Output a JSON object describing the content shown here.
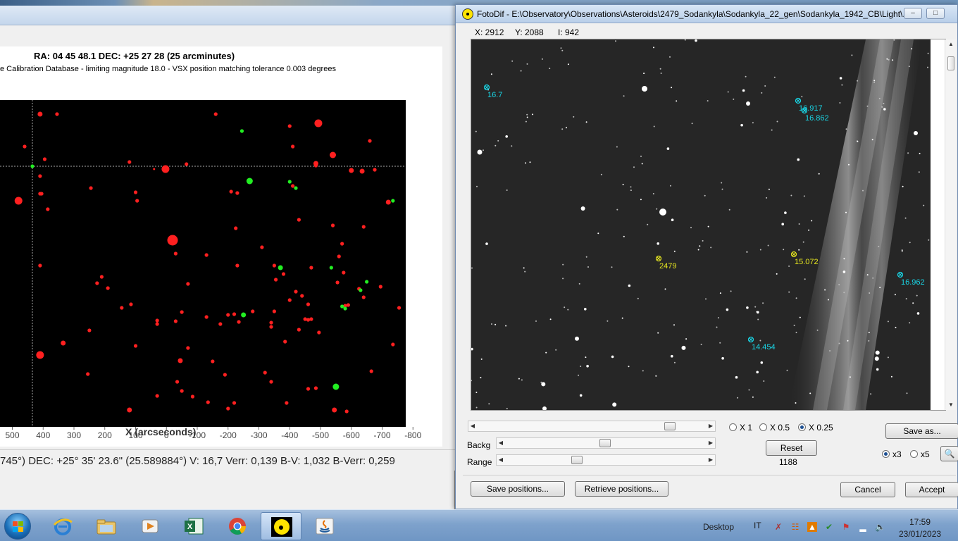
{
  "chart_window": {
    "title": "RA: 04 45 48.1  DEC: +25 27 28 (25 arcminutes)",
    "subtitle": "e Calibration Database - limiting magnitude 18.0 - VSX position matching tolerance 0.003 degrees",
    "x_axis_label": "X (arcseconds)",
    "status": "745°)   DEC: +25° 35' 23.6\" (25.589884°)   V: 16,7    Verr: 0,139   B-V: 1,032   B-Verr: 0,259"
  },
  "chart_data": {
    "type": "scatter",
    "title": "RA: 04 45 48.1  DEC: +25 27 28 (25 arcminutes)",
    "xlabel": "X (arcseconds)",
    "xlim": [
      540,
      -820
    ],
    "x_ticks": [
      "500",
      "400",
      "300",
      "200",
      "100",
      "0",
      "-100",
      "-200",
      "-300",
      "-400",
      "-500",
      "-600",
      "-700",
      "-800"
    ],
    "crosshair": {
      "x": 435
    },
    "series": [
      {
        "color": "#ff2020",
        "points": [
          [
            410,
            20,
            3
          ],
          [
            355,
            20,
            2
          ],
          [
            -160,
            20,
            2
          ],
          [
            -493,
            33,
            5
          ],
          [
            -400,
            37,
            2
          ],
          [
            -660,
            58,
            2
          ],
          [
            460,
            66,
            2
          ],
          [
            -410,
            66,
            2
          ],
          [
            -540,
            78,
            4
          ],
          [
            395,
            84,
            2
          ],
          [
            120,
            88,
            2
          ],
          [
            -485,
            90,
            3
          ],
          [
            -600,
            100,
            3
          ],
          [
            3,
            98,
            5
          ],
          [
            -65,
            91,
            2
          ],
          [
            -635,
            101,
            3
          ],
          [
            -676,
            99,
            2
          ],
          [
            410,
            108,
            2
          ],
          [
            -485,
            93,
            2
          ],
          [
            40,
            98,
            0
          ],
          [
            480,
            143,
            5
          ],
          [
            405,
            133,
            2
          ],
          [
            245,
            125,
            2
          ],
          [
            -230,
            132,
            2
          ],
          [
            -210,
            130,
            2
          ],
          [
            -410,
            122,
            2
          ],
          [
            410,
            133,
            2
          ],
          [
            100,
            131,
            2
          ],
          [
            -720,
            145,
            3
          ],
          [
            385,
            155,
            2
          ],
          [
            95,
            143,
            2
          ],
          [
            -430,
            170,
            2
          ],
          [
            -540,
            178,
            2
          ],
          [
            -640,
            180,
            2
          ],
          [
            -225,
            182,
            2
          ],
          [
            -20,
            199,
            7
          ],
          [
            -30,
            218,
            2
          ],
          [
            -130,
            220,
            2
          ],
          [
            -570,
            204,
            2
          ],
          [
            -310,
            209,
            2
          ],
          [
            -560,
            222,
            2
          ],
          [
            410,
            235,
            2
          ],
          [
            210,
            251,
            2
          ],
          [
            -230,
            235,
            2
          ],
          [
            -350,
            235,
            2
          ],
          [
            -380,
            247,
            2
          ],
          [
            -575,
            245,
            2
          ],
          [
            -470,
            238,
            2
          ],
          [
            225,
            260,
            2
          ],
          [
            190,
            267,
            2
          ],
          [
            -70,
            261,
            2
          ],
          [
            -355,
            255,
            2
          ],
          [
            -555,
            259,
            2
          ],
          [
            -625,
            268,
            2
          ],
          [
            -695,
            265,
            2
          ],
          [
            -420,
            272,
            2
          ],
          [
            -440,
            278,
            2
          ],
          [
            -590,
            291,
            2
          ],
          [
            -640,
            280,
            2
          ],
          [
            -400,
            284,
            2
          ],
          [
            -460,
            290,
            2
          ],
          [
            145,
            295,
            2
          ],
          [
            115,
            290,
            2
          ],
          [
            -350,
            300,
            2
          ],
          [
            -470,
            311,
            2
          ],
          [
            -580,
            292,
            2
          ],
          [
            -200,
            305,
            2
          ],
          [
            -755,
            295,
            2
          ],
          [
            -235,
            315,
            2
          ],
          [
            -50,
            301,
            2
          ],
          [
            -340,
            316,
            2
          ],
          [
            -30,
            314,
            2
          ],
          [
            -175,
            318,
            2
          ],
          [
            250,
            327,
            2
          ],
          [
            30,
            318,
            2
          ],
          [
            30,
            313,
            2
          ],
          [
            -460,
            312,
            2
          ],
          [
            410,
            362,
            5
          ],
          [
            -340,
            322,
            2
          ],
          [
            335,
            345,
            3
          ],
          [
            -385,
            343,
            2
          ],
          [
            -735,
            347,
            2
          ],
          [
            -70,
            352,
            2
          ],
          [
            100,
            349,
            2
          ],
          [
            255,
            389,
            2
          ],
          [
            -45,
            370,
            3
          ],
          [
            -150,
            371,
            2
          ],
          [
            -430,
            326,
            2
          ],
          [
            120,
            440,
            3
          ],
          [
            -340,
            400,
            2
          ],
          [
            -545,
            440,
            3
          ],
          [
            -460,
            410,
            2
          ],
          [
            -85,
            421,
            2
          ],
          [
            -220,
            430,
            2
          ],
          [
            -35,
            400,
            2
          ],
          [
            -200,
            438,
            2
          ],
          [
            -585,
            442,
            2
          ],
          [
            -390,
            430,
            2
          ],
          [
            -135,
            429,
            2
          ],
          [
            -485,
            409,
            2
          ],
          [
            -665,
            385,
            2
          ],
          [
            -50,
            413,
            2
          ],
          [
            30,
            420,
            2
          ],
          [
            -220,
            304,
            2
          ],
          [
            -280,
            300,
            2
          ],
          [
            -130,
            308,
            2
          ],
          [
            -320,
            387,
            2
          ],
          [
            -190,
            390,
            2
          ],
          [
            -450,
            311,
            2
          ],
          [
            -495,
            330,
            2
          ]
        ]
      },
      {
        "color": "#22ee22",
        "points": [
          [
            435,
            94,
            2
          ],
          [
            -245,
            44,
            2
          ],
          [
            -270,
            115,
            4
          ],
          [
            -400,
            116,
            2
          ],
          [
            -420,
            125,
            2
          ],
          [
            -735,
            143,
            2
          ],
          [
            -370,
            238,
            3
          ],
          [
            -535,
            238,
            2
          ],
          [
            -650,
            258,
            2
          ],
          [
            -630,
            270,
            2
          ],
          [
            -580,
            296,
            2
          ],
          [
            -250,
            305,
            3
          ],
          [
            -550,
            407,
            4
          ],
          [
            -570,
            293,
            2
          ]
        ]
      }
    ]
  },
  "fotodif": {
    "title": "FotoDif - E:\\Observatory\\Observations\\Asteroids\\2479_Sodankyla\\Sodankyla_22_gen\\Sodankyla_1942_CB\\Light\\...",
    "x_readout": "X: 2912",
    "y_readout": "Y: 2088",
    "i_readout": "I: 942",
    "image_markers": [
      {
        "label": "16.7",
        "color": "#19d6e6",
        "x": 690,
        "y": 124
      },
      {
        "label": "16.917",
        "color": "#19d6e6",
        "x": 1132,
        "y": 143
      },
      {
        "label": "16.862",
        "color": "#19d6e6",
        "x": 1141,
        "y": 157
      },
      {
        "label": "2479",
        "color": "#e8e820",
        "x": 934,
        "y": 367
      },
      {
        "label": "15.072",
        "color": "#e8e820",
        "x": 1126,
        "y": 361
      },
      {
        "label": "16.962",
        "color": "#19d6e6",
        "x": 1277,
        "y": 390
      },
      {
        "label": "14.454",
        "color": "#19d6e6",
        "x": 1065,
        "y": 482
      }
    ],
    "zoom_options": [
      {
        "label": "X 1",
        "checked": false
      },
      {
        "label": "X 0.5",
        "checked": false
      },
      {
        "label": "X 0.25",
        "checked": true
      }
    ],
    "backg_label": "Backg",
    "range_label": "Range",
    "reset_label": "Reset",
    "reset_value": "1188",
    "save_as_label": "Save as...",
    "scale_options": [
      {
        "label": "x3",
        "checked": true
      },
      {
        "label": "x5",
        "checked": false
      }
    ],
    "save_positions_label": "Save positions...",
    "retrieve_positions_label": "Retrieve positions...",
    "cancel_label": "Cancel",
    "accept_label": "Accept"
  },
  "taskbar": {
    "desktop_label": "Desktop",
    "lang": "IT",
    "time": "17:59",
    "date": "23/01/2023"
  }
}
